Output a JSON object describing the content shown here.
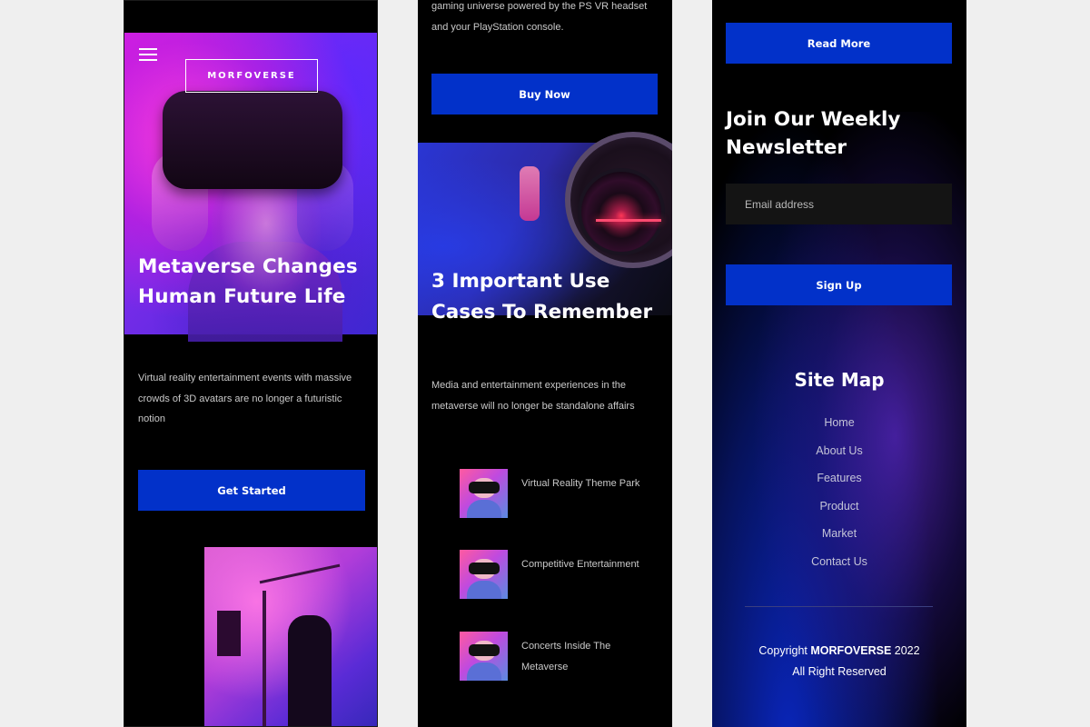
{
  "screen1": {
    "logo": "MORFOVERSE",
    "title": "Metaverse Changes Human Future Life",
    "text": "Virtual reality entertainment events with massive crowds of 3D avatars are no longer a futuristic notion",
    "cta_label": "Get Started"
  },
  "screen2": {
    "intro_text": "gaming universe powered by the PS VR headset and your PlayStation console.",
    "buy_label": "Buy Now",
    "title": "3 Important Use Cases To Remember",
    "text": "Media and entertainment experiences in the metaverse will no longer be standalone affairs",
    "use_cases": [
      {
        "label": "Virtual Reality Theme Park"
      },
      {
        "label": "Competitive Entertainment"
      },
      {
        "label": "Concerts Inside The Metaverse"
      }
    ]
  },
  "screen3": {
    "read_more_label": "Read More",
    "newsletter_title": "Join Our Weekly Newsletter",
    "email_placeholder": "Email address",
    "signup_label": "Sign Up",
    "sitemap_title": "Site Map",
    "sitemap_items": [
      "Home",
      "About Us",
      "Features",
      "Product",
      "Market",
      "Contact Us"
    ],
    "copyright_prefix": "Copyright",
    "copyright_brand": "MORFOVERSE",
    "copyright_year": "2022",
    "rights": "All Right Reserved"
  },
  "colors": {
    "accent_blue": "#0231c9",
    "background": "#000000",
    "page_background": "#efefef",
    "muted_text": "#c9c9c9"
  },
  "icons": {
    "menu": "hamburger-icon"
  }
}
